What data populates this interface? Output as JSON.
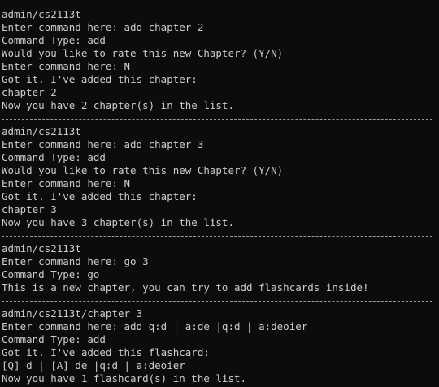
{
  "terminal": {
    "blocks": [
      {
        "prompt_path": "admin/cs2113t",
        "lines": [
          "Enter command here: add chapter 2",
          "Command Type: add",
          "Would you like to rate this new Chapter? (Y/N)",
          "Enter command here: N",
          "Got it. I've added this chapter:",
          "chapter 2",
          "Now you have 2 chapter(s) in the list."
        ]
      },
      {
        "prompt_path": "admin/cs2113t",
        "lines": [
          "Enter command here: add chapter 3",
          "Command Type: add",
          "Would you like to rate this new Chapter? (Y/N)",
          "Enter command here: N",
          "Got it. I've added this chapter:",
          "chapter 3",
          "Now you have 3 chapter(s) in the list."
        ]
      },
      {
        "prompt_path": "admin/cs2113t",
        "lines": [
          "Enter command here: go 3",
          "Command Type: go",
          "This is a new chapter, you can try to add flashcards inside!"
        ]
      },
      {
        "prompt_path": "admin/cs2113t/chapter 3",
        "lines": [
          "Enter command here: add q:d | a:de |q:d | a:deoier",
          "Command Type: add",
          "Got it. I've added this flashcard:",
          "[Q] d | [A] de |q:d | a:deoier",
          "Now you have 1 flashcard(s) in the list."
        ]
      }
    ]
  }
}
